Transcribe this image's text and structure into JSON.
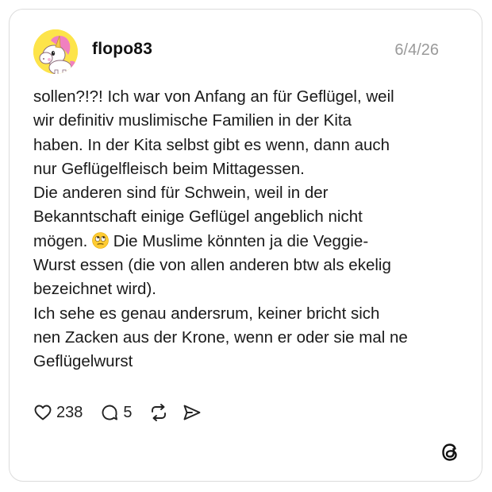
{
  "post": {
    "author": "flopo83",
    "date": "6/4/26",
    "text_lines": [
      "sollen?!?! Ich war von Anfang an für Geflügel, weil",
      "wir definitiv muslimische Familien in der Kita",
      "haben. In der Kita selbst gibt es wenn, dann auch",
      "nur Geflügelfleisch beim Mittagessen.",
      "Die anderen sind für Schwein, weil in der",
      "Bekanntschaft einige Geflügel angeblich nicht",
      "mögen.",
      "Die Muslime könnten ja die Veggie-",
      "Wurst essen (die von allen anderen btw als ekelig",
      "bezeichnet wird).",
      "Ich sehe es genau andersrum, keiner bricht sich",
      "nen Zacken aus der Krone, wenn er oder sie mal ne",
      "Geflügelwurst"
    ],
    "emoji": "face-with-rolling-eyes"
  },
  "actions": {
    "like_count": "238",
    "reply_count": "5",
    "icons": [
      "heart-icon",
      "comment-icon",
      "repost-icon",
      "share-icon"
    ]
  },
  "branding": {
    "logo": "threads-logo-icon"
  },
  "colors": {
    "avatar_bg": "#fde44a",
    "text": "#1a1a1a",
    "muted": "#9a9a9a",
    "border": "#dcdcdc"
  }
}
